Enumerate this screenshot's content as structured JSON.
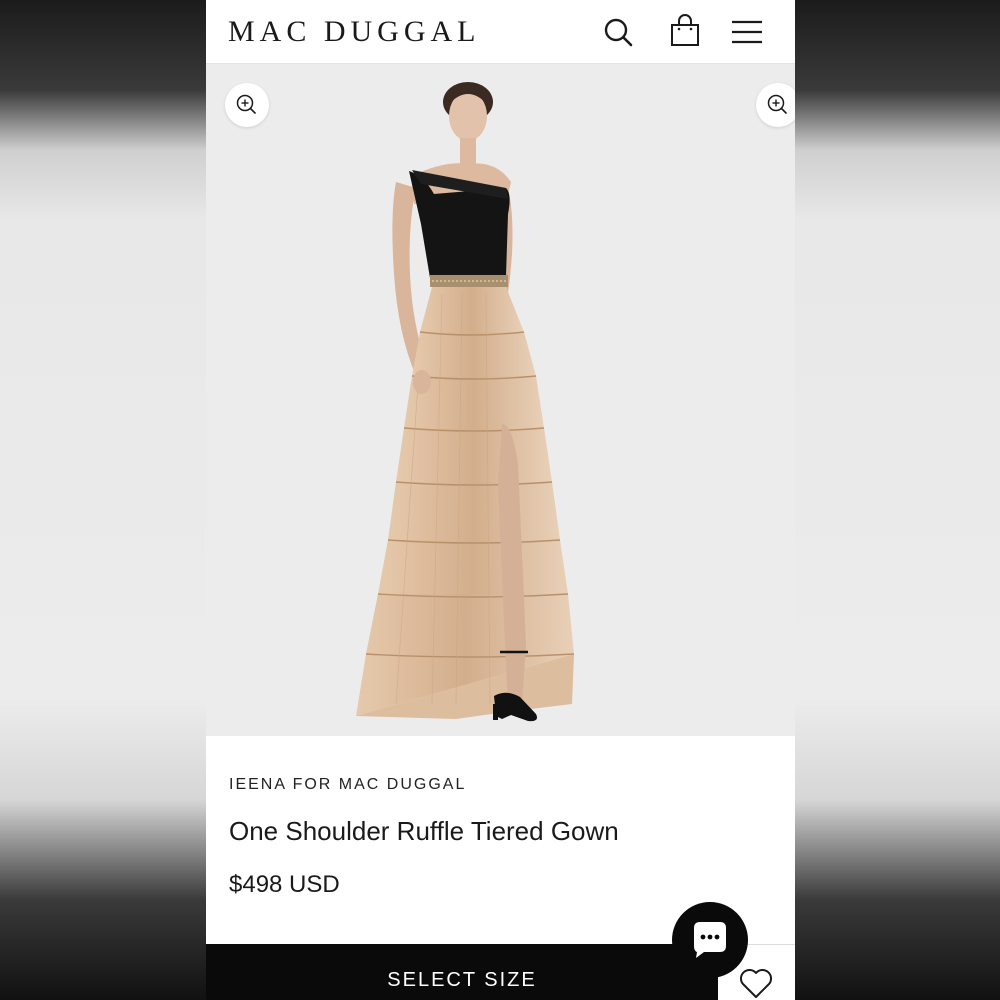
{
  "header": {
    "logo": "MAC DUGGAL",
    "icons": [
      "search-icon",
      "shopping-bag-icon",
      "menu-icon"
    ]
  },
  "gallery": {
    "zoom_icons": [
      "zoom-in-icon",
      "zoom-in-icon"
    ],
    "image_subject": "model wearing one shoulder ruffle tiered gown"
  },
  "product": {
    "brand": "IEENA FOR MAC DUGGAL",
    "title": "One Shoulder Ruffle Tiered Gown",
    "price": "$498 USD"
  },
  "actions": {
    "select_size_label": "SELECT SIZE",
    "wishlist_icon": "heart-icon",
    "chat_icon": "chat-bubble-icon"
  },
  "colors": {
    "primary": "#0a0a0a",
    "background": "#ffffff",
    "gallery_bg": "#ececec",
    "gown_bodice": "#141414",
    "gown_skirt": "#d9b898"
  }
}
